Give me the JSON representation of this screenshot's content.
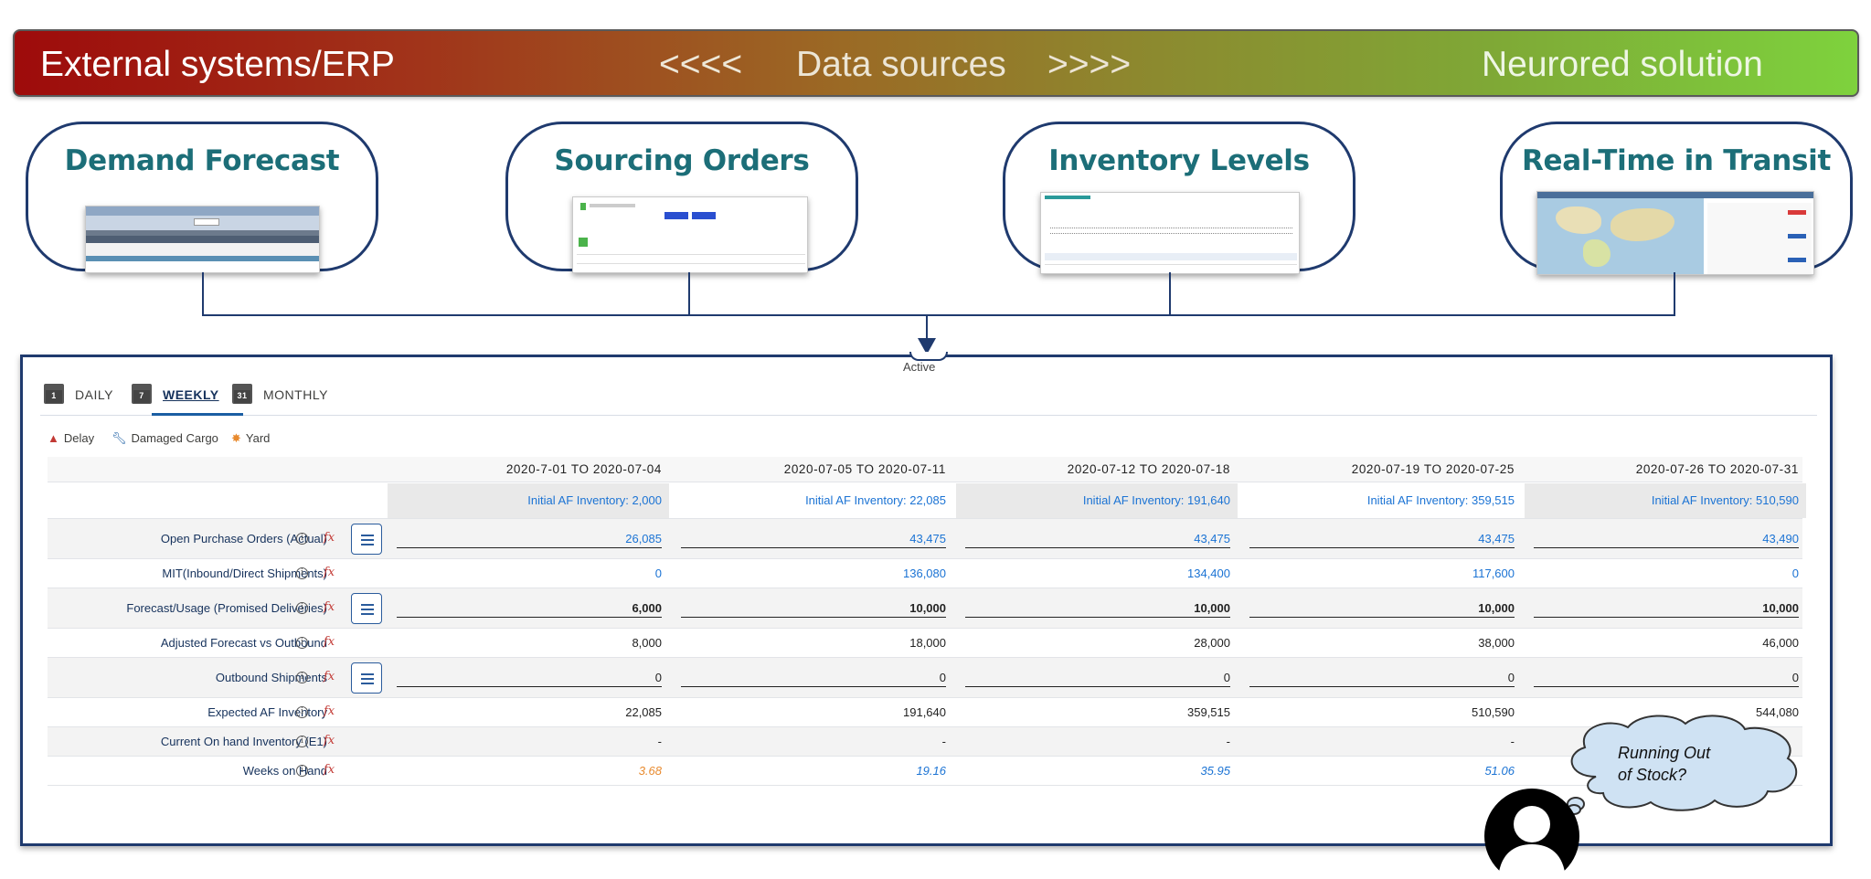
{
  "banner": {
    "left": "External systems/ERP",
    "arrows_left": "<<<<",
    "middle": "Data sources",
    "arrows_right": ">>>>",
    "right": "Neurored solution"
  },
  "sources": [
    {
      "title": "Demand Forecast"
    },
    {
      "title": "Sourcing Orders"
    },
    {
      "title": "Inventory Levels"
    },
    {
      "title": "Real-Time in Transit"
    }
  ],
  "panel": {
    "active_label": "Active",
    "tabs": [
      {
        "label": "DAILY",
        "icon_number": "1"
      },
      {
        "label": "WEEKLY",
        "icon_number": "7"
      },
      {
        "label": "MONTHLY",
        "icon_number": "31"
      }
    ],
    "legend": [
      {
        "label": "Delay",
        "icon": "warning-icon"
      },
      {
        "label": "Damaged Cargo",
        "icon": "wrench-icon"
      },
      {
        "label": "Yard",
        "icon": "yard-icon"
      }
    ],
    "columns": [
      {
        "range": "2020-7-01 TO 2020-07-04",
        "initial": "Initial AF Inventory: 2,000"
      },
      {
        "range": "2020-07-05 TO 2020-07-11",
        "initial": "Initial AF Inventory: 22,085"
      },
      {
        "range": "2020-07-12 TO 2020-07-18",
        "initial": "Initial AF Inventory: 191,640"
      },
      {
        "range": "2020-07-19 TO 2020-07-25",
        "initial": "Initial AF Inventory: 359,515"
      },
      {
        "range": "2020-07-26 TO 2020-07-31",
        "initial": "Initial AF Inventory: 510,590"
      }
    ],
    "rows": [
      {
        "label": "Open Purchase Orders (Actual)",
        "values": [
          "26,085",
          "43,475",
          "43,475",
          "43,475",
          "43,490"
        ]
      },
      {
        "label": "MIT(Inbound/Direct Shipments)",
        "values": [
          "0",
          "136,080",
          "134,400",
          "117,600",
          "0"
        ]
      },
      {
        "label": "Forecast/Usage (Promised Deliveries)",
        "values": [
          "6,000",
          "10,000",
          "10,000",
          "10,000",
          "10,000"
        ]
      },
      {
        "label": "Adjusted Forecast vs Outbound",
        "values": [
          "8,000",
          "18,000",
          "28,000",
          "38,000",
          "46,000"
        ]
      },
      {
        "label": "Outbound Shipments",
        "values": [
          "0",
          "0",
          "0",
          "0",
          "0"
        ]
      },
      {
        "label": "Expected AF Inventory",
        "values": [
          "22,085",
          "191,640",
          "359,515",
          "510,590",
          "544,080"
        ]
      },
      {
        "label": "Current On hand Inventory (E1)",
        "values": [
          "-",
          "-",
          "-",
          "-",
          ""
        ]
      },
      {
        "label": "Weeks on Hand",
        "values": [
          "3.68",
          "19.16",
          "35.95",
          "51.06",
          ""
        ]
      }
    ]
  },
  "thought": {
    "line1": "Running Out",
    "line2": "of Stock?"
  },
  "colors": {
    "banner_start": "#9e0b0b",
    "banner_end": "#7ed23d",
    "title_teal": "#1c6e78",
    "border_navy": "#1f3a6e",
    "link_blue": "#1b73d4",
    "orange": "#e88a2e"
  }
}
